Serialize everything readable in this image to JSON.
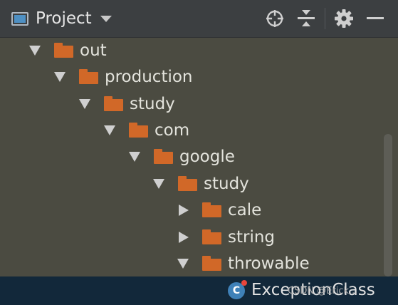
{
  "header": {
    "title": "Project",
    "icons": [
      "window-icon",
      "chevron-down-icon",
      "locate-icon",
      "collapse-all-icon",
      "gear-icon",
      "minimize-icon"
    ]
  },
  "tree": {
    "items": [
      {
        "label": "out",
        "expanded": true
      },
      {
        "label": "production",
        "expanded": true
      },
      {
        "label": "study",
        "expanded": true
      },
      {
        "label": "com",
        "expanded": true
      },
      {
        "label": "google",
        "expanded": true
      },
      {
        "label": "study",
        "expanded": true
      },
      {
        "label": "cale",
        "expanded": false
      },
      {
        "label": "string",
        "expanded": false
      },
      {
        "label": "throwable",
        "expanded": true
      }
    ],
    "selected": {
      "label": "ExceptionClass",
      "icon": "class-icon",
      "icon_letter": "C"
    }
  },
  "watermark": "CSDN @Erick...",
  "colors": {
    "background": "#4b4b41",
    "header": "#3c3f41",
    "folder": "#d16828",
    "selection": "#12283a",
    "class_icon": "#3f81b8"
  }
}
